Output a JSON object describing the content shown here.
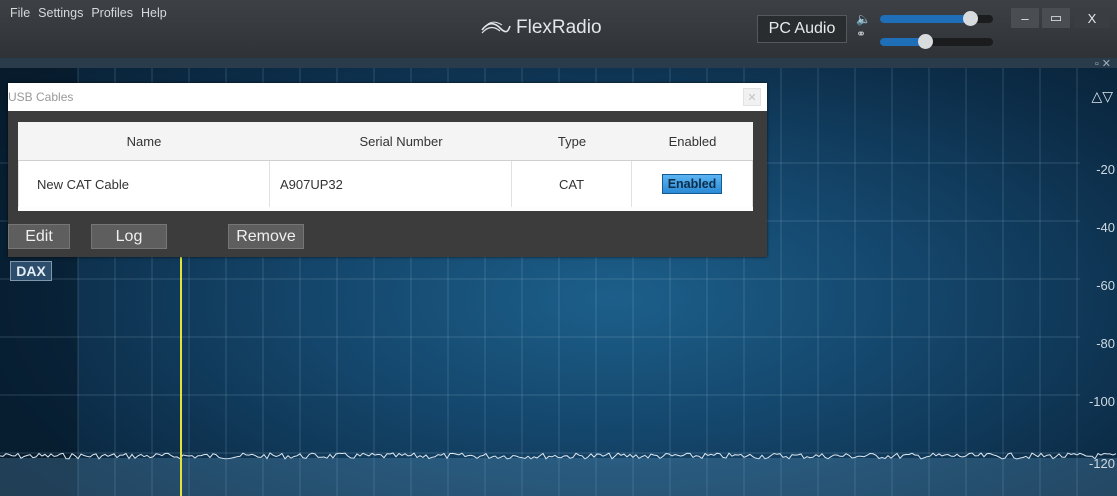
{
  "menu": [
    "File",
    "Settings",
    "Profiles",
    "Help"
  ],
  "app": {
    "brand": "FlexRadio"
  },
  "audio": {
    "output_label": "PC Audio",
    "speaker_icon": "speaker-icon",
    "headphone_icon": "headphones-icon",
    "speaker_volume": 0.8,
    "headphone_volume": 0.4
  },
  "window_controls": {
    "minimize": "–",
    "restore": "▭",
    "close": "X"
  },
  "dialog": {
    "title": "USB Cables",
    "columns": [
      "Name",
      "Serial Number",
      "Type",
      "Enabled"
    ],
    "rows": [
      {
        "name": "New CAT Cable",
        "serial": "A907UP32",
        "type": "CAT",
        "enabled": "Enabled"
      }
    ],
    "buttons": {
      "edit": "Edit",
      "log": "Log",
      "remove": "Remove"
    }
  },
  "panadapter": {
    "dax_label": "DAX",
    "db_labels": [
      "-20",
      "-40",
      "-60",
      "-80",
      "-100",
      "-120"
    ],
    "colors": {
      "marker": "#e6e23c",
      "background": "#14456a",
      "enabled_button": "#3a9be3"
    }
  }
}
